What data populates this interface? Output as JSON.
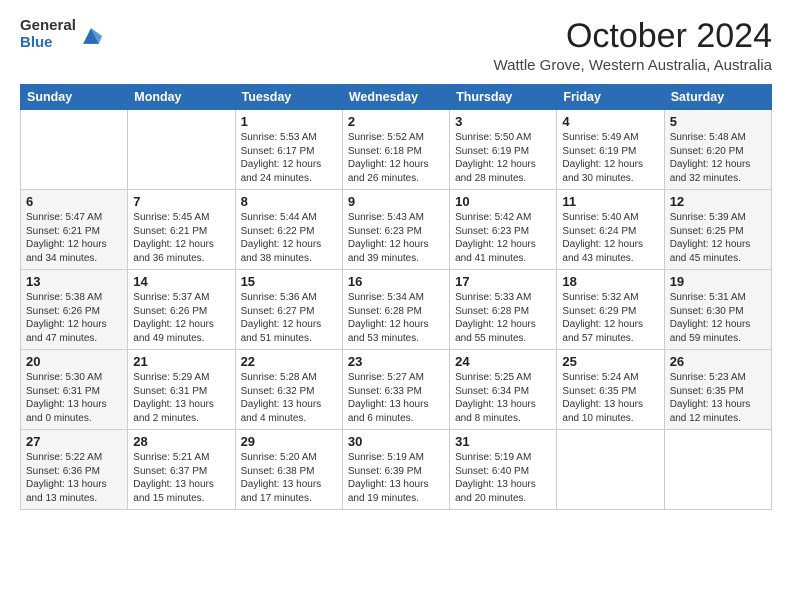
{
  "logo": {
    "general": "General",
    "blue": "Blue"
  },
  "header": {
    "month": "October 2024",
    "location": "Wattle Grove, Western Australia, Australia"
  },
  "weekdays": [
    "Sunday",
    "Monday",
    "Tuesday",
    "Wednesday",
    "Thursday",
    "Friday",
    "Saturday"
  ],
  "weeks": [
    [
      {
        "day": "",
        "sunrise": "",
        "sunset": "",
        "daylight": ""
      },
      {
        "day": "",
        "sunrise": "",
        "sunset": "",
        "daylight": ""
      },
      {
        "day": "1",
        "sunrise": "Sunrise: 5:53 AM",
        "sunset": "Sunset: 6:17 PM",
        "daylight": "Daylight: 12 hours and 24 minutes."
      },
      {
        "day": "2",
        "sunrise": "Sunrise: 5:52 AM",
        "sunset": "Sunset: 6:18 PM",
        "daylight": "Daylight: 12 hours and 26 minutes."
      },
      {
        "day": "3",
        "sunrise": "Sunrise: 5:50 AM",
        "sunset": "Sunset: 6:19 PM",
        "daylight": "Daylight: 12 hours and 28 minutes."
      },
      {
        "day": "4",
        "sunrise": "Sunrise: 5:49 AM",
        "sunset": "Sunset: 6:19 PM",
        "daylight": "Daylight: 12 hours and 30 minutes."
      },
      {
        "day": "5",
        "sunrise": "Sunrise: 5:48 AM",
        "sunset": "Sunset: 6:20 PM",
        "daylight": "Daylight: 12 hours and 32 minutes."
      }
    ],
    [
      {
        "day": "6",
        "sunrise": "Sunrise: 5:47 AM",
        "sunset": "Sunset: 6:21 PM",
        "daylight": "Daylight: 12 hours and 34 minutes."
      },
      {
        "day": "7",
        "sunrise": "Sunrise: 5:45 AM",
        "sunset": "Sunset: 6:21 PM",
        "daylight": "Daylight: 12 hours and 36 minutes."
      },
      {
        "day": "8",
        "sunrise": "Sunrise: 5:44 AM",
        "sunset": "Sunset: 6:22 PM",
        "daylight": "Daylight: 12 hours and 38 minutes."
      },
      {
        "day": "9",
        "sunrise": "Sunrise: 5:43 AM",
        "sunset": "Sunset: 6:23 PM",
        "daylight": "Daylight: 12 hours and 39 minutes."
      },
      {
        "day": "10",
        "sunrise": "Sunrise: 5:42 AM",
        "sunset": "Sunset: 6:23 PM",
        "daylight": "Daylight: 12 hours and 41 minutes."
      },
      {
        "day": "11",
        "sunrise": "Sunrise: 5:40 AM",
        "sunset": "Sunset: 6:24 PM",
        "daylight": "Daylight: 12 hours and 43 minutes."
      },
      {
        "day": "12",
        "sunrise": "Sunrise: 5:39 AM",
        "sunset": "Sunset: 6:25 PM",
        "daylight": "Daylight: 12 hours and 45 minutes."
      }
    ],
    [
      {
        "day": "13",
        "sunrise": "Sunrise: 5:38 AM",
        "sunset": "Sunset: 6:26 PM",
        "daylight": "Daylight: 12 hours and 47 minutes."
      },
      {
        "day": "14",
        "sunrise": "Sunrise: 5:37 AM",
        "sunset": "Sunset: 6:26 PM",
        "daylight": "Daylight: 12 hours and 49 minutes."
      },
      {
        "day": "15",
        "sunrise": "Sunrise: 5:36 AM",
        "sunset": "Sunset: 6:27 PM",
        "daylight": "Daylight: 12 hours and 51 minutes."
      },
      {
        "day": "16",
        "sunrise": "Sunrise: 5:34 AM",
        "sunset": "Sunset: 6:28 PM",
        "daylight": "Daylight: 12 hours and 53 minutes."
      },
      {
        "day": "17",
        "sunrise": "Sunrise: 5:33 AM",
        "sunset": "Sunset: 6:28 PM",
        "daylight": "Daylight: 12 hours and 55 minutes."
      },
      {
        "day": "18",
        "sunrise": "Sunrise: 5:32 AM",
        "sunset": "Sunset: 6:29 PM",
        "daylight": "Daylight: 12 hours and 57 minutes."
      },
      {
        "day": "19",
        "sunrise": "Sunrise: 5:31 AM",
        "sunset": "Sunset: 6:30 PM",
        "daylight": "Daylight: 12 hours and 59 minutes."
      }
    ],
    [
      {
        "day": "20",
        "sunrise": "Sunrise: 5:30 AM",
        "sunset": "Sunset: 6:31 PM",
        "daylight": "Daylight: 13 hours and 0 minutes."
      },
      {
        "day": "21",
        "sunrise": "Sunrise: 5:29 AM",
        "sunset": "Sunset: 6:31 PM",
        "daylight": "Daylight: 13 hours and 2 minutes."
      },
      {
        "day": "22",
        "sunrise": "Sunrise: 5:28 AM",
        "sunset": "Sunset: 6:32 PM",
        "daylight": "Daylight: 13 hours and 4 minutes."
      },
      {
        "day": "23",
        "sunrise": "Sunrise: 5:27 AM",
        "sunset": "Sunset: 6:33 PM",
        "daylight": "Daylight: 13 hours and 6 minutes."
      },
      {
        "day": "24",
        "sunrise": "Sunrise: 5:25 AM",
        "sunset": "Sunset: 6:34 PM",
        "daylight": "Daylight: 13 hours and 8 minutes."
      },
      {
        "day": "25",
        "sunrise": "Sunrise: 5:24 AM",
        "sunset": "Sunset: 6:35 PM",
        "daylight": "Daylight: 13 hours and 10 minutes."
      },
      {
        "day": "26",
        "sunrise": "Sunrise: 5:23 AM",
        "sunset": "Sunset: 6:35 PM",
        "daylight": "Daylight: 13 hours and 12 minutes."
      }
    ],
    [
      {
        "day": "27",
        "sunrise": "Sunrise: 5:22 AM",
        "sunset": "Sunset: 6:36 PM",
        "daylight": "Daylight: 13 hours and 13 minutes."
      },
      {
        "day": "28",
        "sunrise": "Sunrise: 5:21 AM",
        "sunset": "Sunset: 6:37 PM",
        "daylight": "Daylight: 13 hours and 15 minutes."
      },
      {
        "day": "29",
        "sunrise": "Sunrise: 5:20 AM",
        "sunset": "Sunset: 6:38 PM",
        "daylight": "Daylight: 13 hours and 17 minutes."
      },
      {
        "day": "30",
        "sunrise": "Sunrise: 5:19 AM",
        "sunset": "Sunset: 6:39 PM",
        "daylight": "Daylight: 13 hours and 19 minutes."
      },
      {
        "day": "31",
        "sunrise": "Sunrise: 5:19 AM",
        "sunset": "Sunset: 6:40 PM",
        "daylight": "Daylight: 13 hours and 20 minutes."
      },
      {
        "day": "",
        "sunrise": "",
        "sunset": "",
        "daylight": ""
      },
      {
        "day": "",
        "sunrise": "",
        "sunset": "",
        "daylight": ""
      }
    ]
  ]
}
